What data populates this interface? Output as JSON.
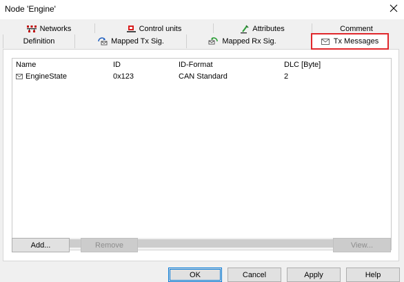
{
  "window": {
    "title": "Node 'Engine'"
  },
  "tabs_row1": [
    {
      "label": "Networks",
      "icon": "networks-icon"
    },
    {
      "label": "Control units",
      "icon": "control-units-icon"
    },
    {
      "label": "Attributes",
      "icon": "attributes-icon"
    },
    {
      "label": "Comment",
      "icon": ""
    }
  ],
  "tabs_row2": [
    {
      "label": "Definition",
      "icon": ""
    },
    {
      "label": "Mapped Tx Sig.",
      "icon": "mapped-tx-sig-icon"
    },
    {
      "label": "Mapped Rx Sig.",
      "icon": "mapped-rx-sig-icon"
    },
    {
      "label": "Tx Messages",
      "icon": "envelope-icon",
      "active": true
    }
  ],
  "table": {
    "columns": [
      "Name",
      "ID",
      "ID-Format",
      "DLC [Byte]"
    ],
    "rows": [
      {
        "name": "EngineState",
        "id": "0x123",
        "format": "CAN Standard",
        "dlc": "2"
      }
    ]
  },
  "buttons": {
    "add": "Add...",
    "remove": "Remove",
    "view": "View...",
    "ok": "OK",
    "cancel": "Cancel",
    "apply": "Apply",
    "help": "Help"
  },
  "colors": {
    "highlight_border": "#e0262a",
    "default_button_border": "#0078d7",
    "dialog_background": "#f0f0f0"
  }
}
